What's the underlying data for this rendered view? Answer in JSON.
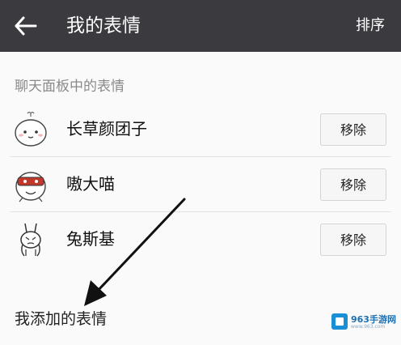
{
  "header": {
    "title": "我的表情",
    "sort_label": "排序",
    "back_icon": "arrow-left-icon"
  },
  "panel_section": {
    "title": "聊天面板中的表情",
    "items": [
      {
        "name": "长草颜团子",
        "action": "移除",
        "thumb_icon": "chang-cao-yan-tuan-zi-sticker-icon"
      },
      {
        "name": "嗷大喵",
        "action": "移除",
        "thumb_icon": "ao-da-miao-sticker-icon"
      },
      {
        "name": "兔斯基",
        "action": "移除",
        "thumb_icon": "tuzki-sticker-icon"
      }
    ]
  },
  "added_section": {
    "title": "我添加的表情"
  },
  "watermark": {
    "text": "963手游网",
    "sub": "www.963.com"
  },
  "colors": {
    "header_bg": "#3b3b3f",
    "page_bg": "#fafafa",
    "section_title": "#8a8a8a"
  }
}
